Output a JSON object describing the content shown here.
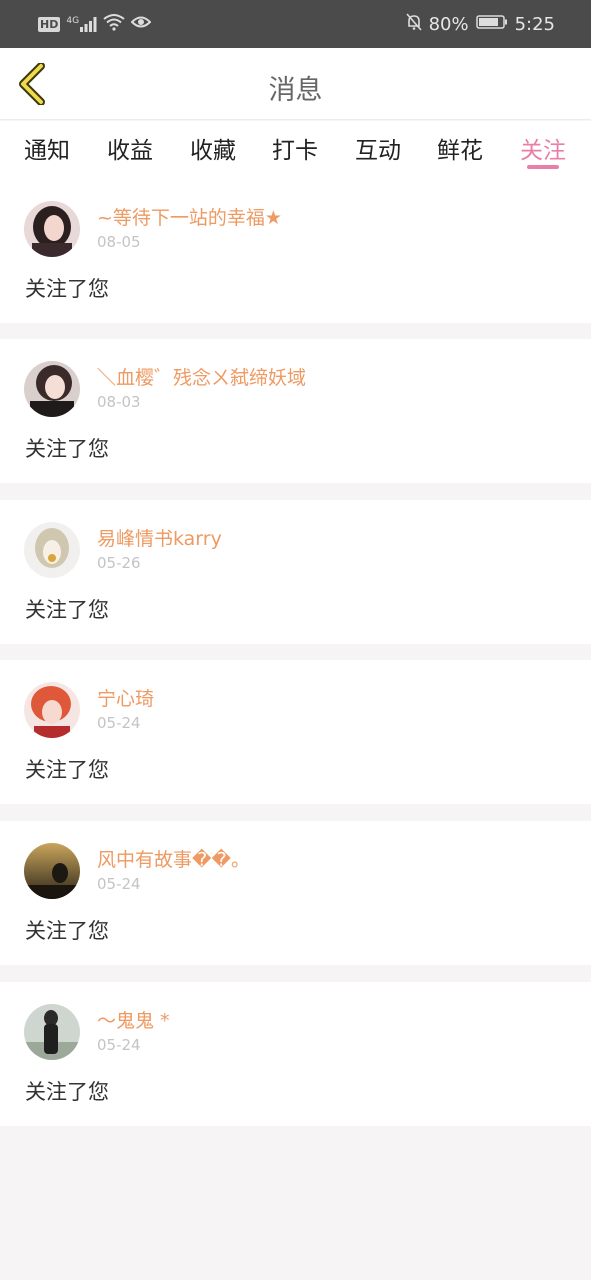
{
  "status": {
    "hd": "HD",
    "network": "4G",
    "battery_pct": "80%",
    "time": "5:25"
  },
  "header": {
    "title": "消息"
  },
  "tabs": [
    {
      "label": "通知"
    },
    {
      "label": "收益"
    },
    {
      "label": "收藏"
    },
    {
      "label": "打卡"
    },
    {
      "label": "互动"
    },
    {
      "label": "鲜花"
    },
    {
      "label": "关注"
    }
  ],
  "active_tab": "关注",
  "colors": {
    "accent": "#e97fa8",
    "username": "#ee9a62",
    "statusbar": "#4b4b4b"
  },
  "items": [
    {
      "name": "~等待下一站的幸福★",
      "date": "08-05",
      "message": "关注了您"
    },
    {
      "name": "＼血樱゛残念ㄨ弑缔妖域",
      "date": "08-03",
      "message": "关注了您"
    },
    {
      "name": "易峰情书karry",
      "date": "05-26",
      "message": "关注了您"
    },
    {
      "name": "宁心琦",
      "date": "05-24",
      "message": "关注了您"
    },
    {
      "name": "风中有故事��。",
      "date": "05-24",
      "message": "关注了您"
    },
    {
      "name": "～鬼鬼 *",
      "date": "05-24",
      "message": "关注了您"
    }
  ]
}
